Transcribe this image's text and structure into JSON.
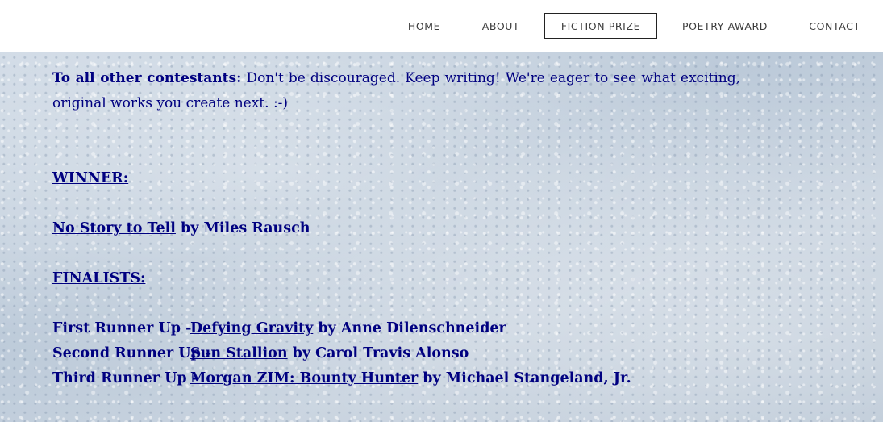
{
  "nav": {
    "items": [
      {
        "label": "HOME"
      },
      {
        "label": "ABOUT"
      },
      {
        "label": "FICTION PRIZE",
        "active": true
      },
      {
        "label": "POETRY AWARD"
      },
      {
        "label": "CONTACT"
      }
    ]
  },
  "intro": {
    "lead": "To all other contestants:",
    "text": " Don't be discouraged. Keep writing! We're eager to see what exciting, original works you create next.  :-)"
  },
  "winner": {
    "heading": "WINNER:",
    "title": "No Story to Tell",
    "byline": " by Miles Rausch"
  },
  "finalists": {
    "heading": "FINALISTS:",
    "items": [
      {
        "rank": "First Runner Up -",
        "title": "Defying Gravity",
        "byline": " by Anne Dilenschneider"
      },
      {
        "rank": "Second Runner Up -",
        "title": "Sun Stallion",
        "byline": " by Carol Travis Alonso"
      },
      {
        "rank": "Third Runner Up -",
        "title": "Morgan ZIM: Bounty Hunter",
        "byline": " by Michael Stangeland, Jr."
      }
    ]
  },
  "colors": {
    "text": "#000080",
    "nav_text": "#3a3a3a",
    "nav_background": "#ffffff"
  }
}
